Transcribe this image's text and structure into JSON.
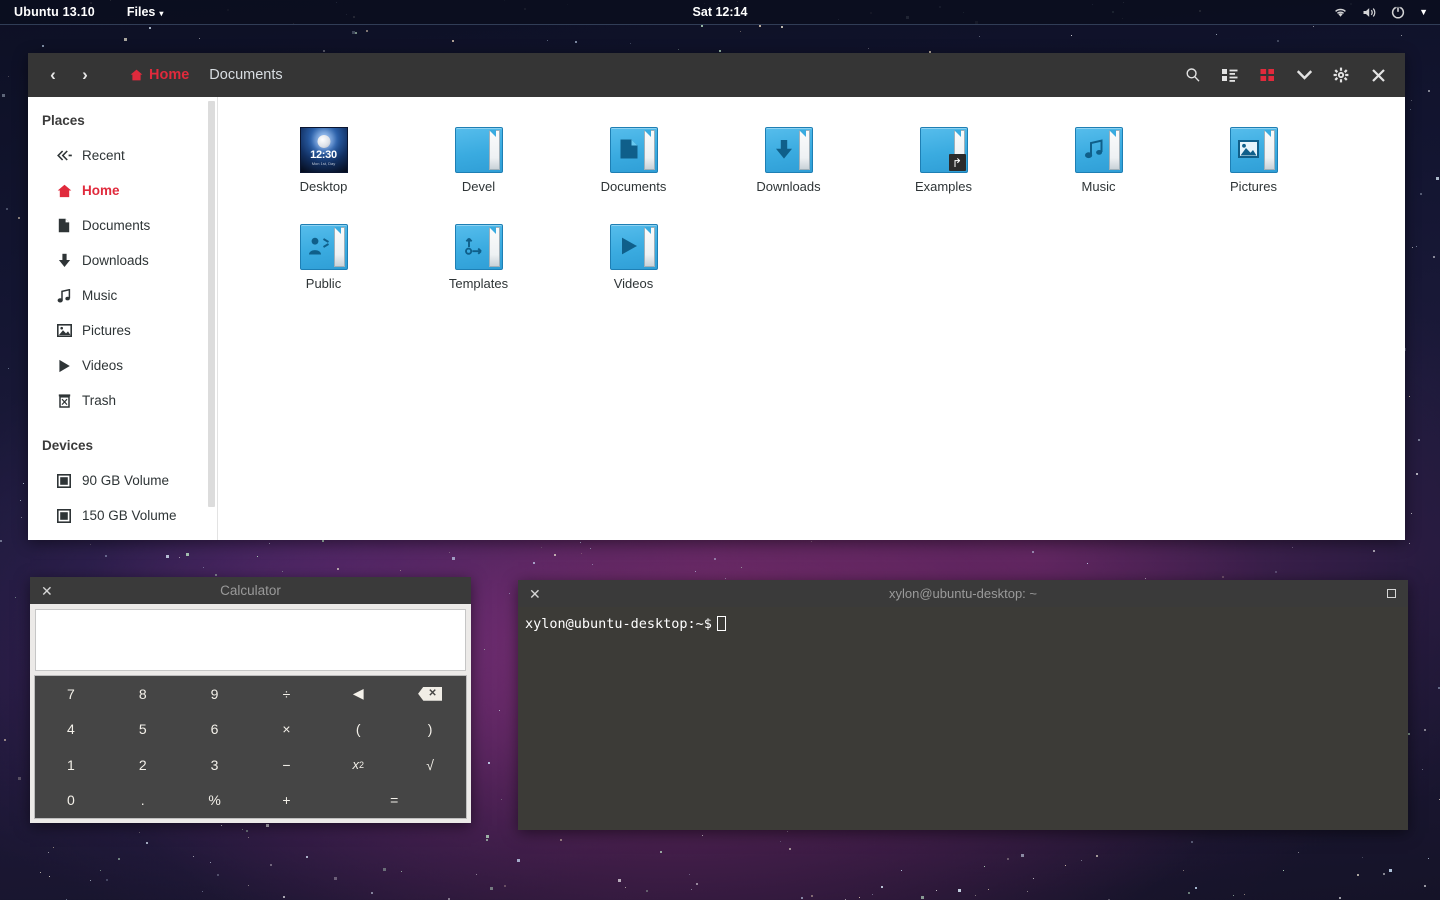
{
  "panel": {
    "distro": "Ubuntu 13.10",
    "app_menu": "Files",
    "app_menu_caret": "▾",
    "clock": "Sat 12:14",
    "tray": [
      {
        "name": "wifi-icon",
        "glyph": "wifi"
      },
      {
        "name": "volume-icon",
        "glyph": "volume"
      },
      {
        "name": "power-icon",
        "glyph": "power"
      },
      {
        "name": "session-caret-icon",
        "glyph": "▼"
      }
    ]
  },
  "file_manager": {
    "nav": {
      "back": "‹",
      "forward": "›"
    },
    "breadcrumbs": [
      {
        "label": "Home",
        "active": true
      },
      {
        "label": "Documents",
        "active": false
      }
    ],
    "tools": [
      {
        "name": "search-icon",
        "label": "Search"
      },
      {
        "name": "list-view-icon",
        "label": "List view"
      },
      {
        "name": "grid-view-icon",
        "label": "Grid view"
      },
      {
        "name": "chevron-down-icon",
        "label": "View options"
      },
      {
        "name": "gear-icon",
        "label": "Settings"
      },
      {
        "name": "close-icon",
        "label": "Close"
      }
    ],
    "sidebar": {
      "places_header": "Places",
      "places": [
        {
          "label": "Recent",
          "icon": "recent-icon",
          "active": false
        },
        {
          "label": "Home",
          "icon": "home-icon",
          "active": true
        },
        {
          "label": "Documents",
          "icon": "document-icon",
          "active": false
        },
        {
          "label": "Downloads",
          "icon": "download-icon",
          "active": false
        },
        {
          "label": "Music",
          "icon": "music-icon",
          "active": false
        },
        {
          "label": "Pictures",
          "icon": "picture-icon",
          "active": false
        },
        {
          "label": "Videos",
          "icon": "video-icon",
          "active": false
        },
        {
          "label": "Trash",
          "icon": "trash-icon",
          "active": false
        }
      ],
      "devices_header": "Devices",
      "devices": [
        {
          "label": "90 GB Volume",
          "icon": "drive-icon"
        },
        {
          "label": "150 GB Volume",
          "icon": "drive-icon"
        }
      ]
    },
    "files": [
      {
        "label": "Desktop",
        "type": "thumbnail",
        "thumb_time": "12:30",
        "thumb_date": "Mon 1st, Day"
      },
      {
        "label": "Devel",
        "type": "folder",
        "emblem": ""
      },
      {
        "label": "Documents",
        "type": "folder",
        "emblem": "document"
      },
      {
        "label": "Downloads",
        "type": "folder",
        "emblem": "download"
      },
      {
        "label": "Examples",
        "type": "folder",
        "emblem": "",
        "link": true
      },
      {
        "label": "Music",
        "type": "folder",
        "emblem": "music"
      },
      {
        "label": "Pictures",
        "type": "folder",
        "emblem": "picture"
      },
      {
        "label": "Public",
        "type": "folder",
        "emblem": "share"
      },
      {
        "label": "Templates",
        "type": "folder",
        "emblem": "template"
      },
      {
        "label": "Videos",
        "type": "folder",
        "emblem": "video"
      }
    ]
  },
  "calculator": {
    "title": "Calculator",
    "close": "✕",
    "display_value": "",
    "keys": [
      {
        "label": "7",
        "name": "key-7"
      },
      {
        "label": "8",
        "name": "key-8"
      },
      {
        "label": "9",
        "name": "key-9"
      },
      {
        "label": "÷",
        "name": "key-divide"
      },
      {
        "label": "◀",
        "name": "key-left-arrow"
      },
      {
        "label": "⌫",
        "name": "key-backspace"
      },
      {
        "label": "4",
        "name": "key-4"
      },
      {
        "label": "5",
        "name": "key-5"
      },
      {
        "label": "6",
        "name": "key-6"
      },
      {
        "label": "×",
        "name": "key-multiply"
      },
      {
        "label": "(",
        "name": "key-open-paren"
      },
      {
        "label": ")",
        "name": "key-close-paren"
      },
      {
        "label": "1",
        "name": "key-1"
      },
      {
        "label": "2",
        "name": "key-2"
      },
      {
        "label": "3",
        "name": "key-3"
      },
      {
        "label": "−",
        "name": "key-minus"
      },
      {
        "label": "x²",
        "name": "key-square"
      },
      {
        "label": "√",
        "name": "key-sqrt"
      },
      {
        "label": "0",
        "name": "key-0"
      },
      {
        "label": ".",
        "name": "key-decimal"
      },
      {
        "label": "%",
        "name": "key-percent"
      },
      {
        "label": "+",
        "name": "key-plus"
      },
      {
        "label": "=",
        "name": "key-equals"
      }
    ]
  },
  "terminal": {
    "title": "xylon@ubuntu-desktop: ~",
    "close": "✕",
    "prompt": "xylon@ubuntu-desktop:~$"
  },
  "colors": {
    "accent_red": "#e02a3c",
    "header_dark": "#353535",
    "panel_dark": "#0a0e1e",
    "folder_blue": "#3aabe0",
    "terminal_bg": "#3c3b37"
  }
}
